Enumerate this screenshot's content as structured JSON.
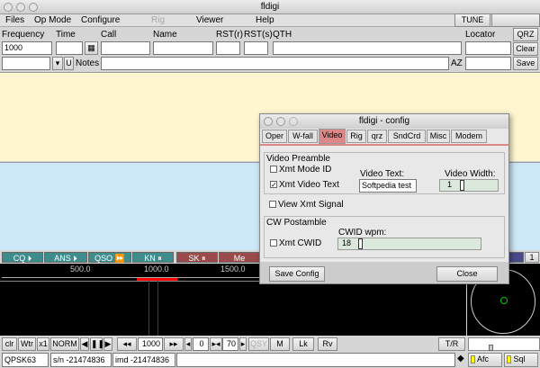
{
  "window": {
    "title": "fldigi"
  },
  "menu": {
    "items": [
      "Files",
      "Op Mode",
      "Configure",
      "Rig",
      "Viewer",
      "Help"
    ],
    "tune": "TUNE"
  },
  "log": {
    "frequency_label": "Frequency",
    "frequency_value": "1000",
    "time_label": "Time",
    "call_label": "Call",
    "name_label": "Name",
    "rstr_label": "RST(r)",
    "rsts_label": "RST(s)",
    "qth_label": "QTH",
    "locator_label": "Locator",
    "qrz": "QRZ",
    "clear": "Clear",
    "save": "Save",
    "u": "U",
    "notes_label": "Notes",
    "az_label": "AZ"
  },
  "macros": [
    {
      "label": "CQ ⏵",
      "color": "#3f8c8c"
    },
    {
      "label": "ANS ⏵",
      "color": "#3f8c8c"
    },
    {
      "label": "QSO ⏩",
      "color": "#3f8c8c"
    },
    {
      "label": "KN ⏸",
      "color": "#3f8c8c"
    },
    {
      "label": "SK ⏸",
      "color": "#9a4a4a"
    },
    {
      "label": "Me",
      "color": "#9a4a4a"
    }
  ],
  "macro_page": "1",
  "waterfall": {
    "scale": [
      "500.0",
      "1000.0",
      "1500.0"
    ]
  },
  "controls": {
    "clr": "clr",
    "wtr": "Wtr",
    "x1": "x1",
    "norm": "NORM",
    "freq": "1000",
    "offset": "0",
    "level": "70",
    "qsy": "QSY",
    "m": "M",
    "lk": "Lk",
    "rv": "Rv",
    "tr": "T/R"
  },
  "status": {
    "mode": "QPSK63",
    "sn": "s/n -21474836",
    "imd": "imd -21474836",
    "afc": "Afc",
    "sql": "Sql"
  },
  "config": {
    "title": "fldigi - config",
    "tabs": [
      "Oper",
      "W-fall",
      "Video",
      "Rig",
      "qrz",
      "SndCrd",
      "Misc",
      "Modem"
    ],
    "active_tab": "Video",
    "preamble_label": "Video Preamble",
    "xmt_mode_id": "Xmt Mode ID",
    "xmt_video_text": "Xmt Video Text",
    "video_text_label": "Video Text:",
    "video_text_value": "Softpedia test",
    "video_width_label": "Video Width:",
    "video_width_value": "1",
    "view_xmt": "View Xmt Signal",
    "postamble_label": "CW Postamble",
    "xmt_cwid": "Xmt CWID",
    "cwid_wpm_label": "CWID wpm:",
    "cwid_wpm_value": "18",
    "save_config": "Save Config",
    "close": "Close"
  }
}
